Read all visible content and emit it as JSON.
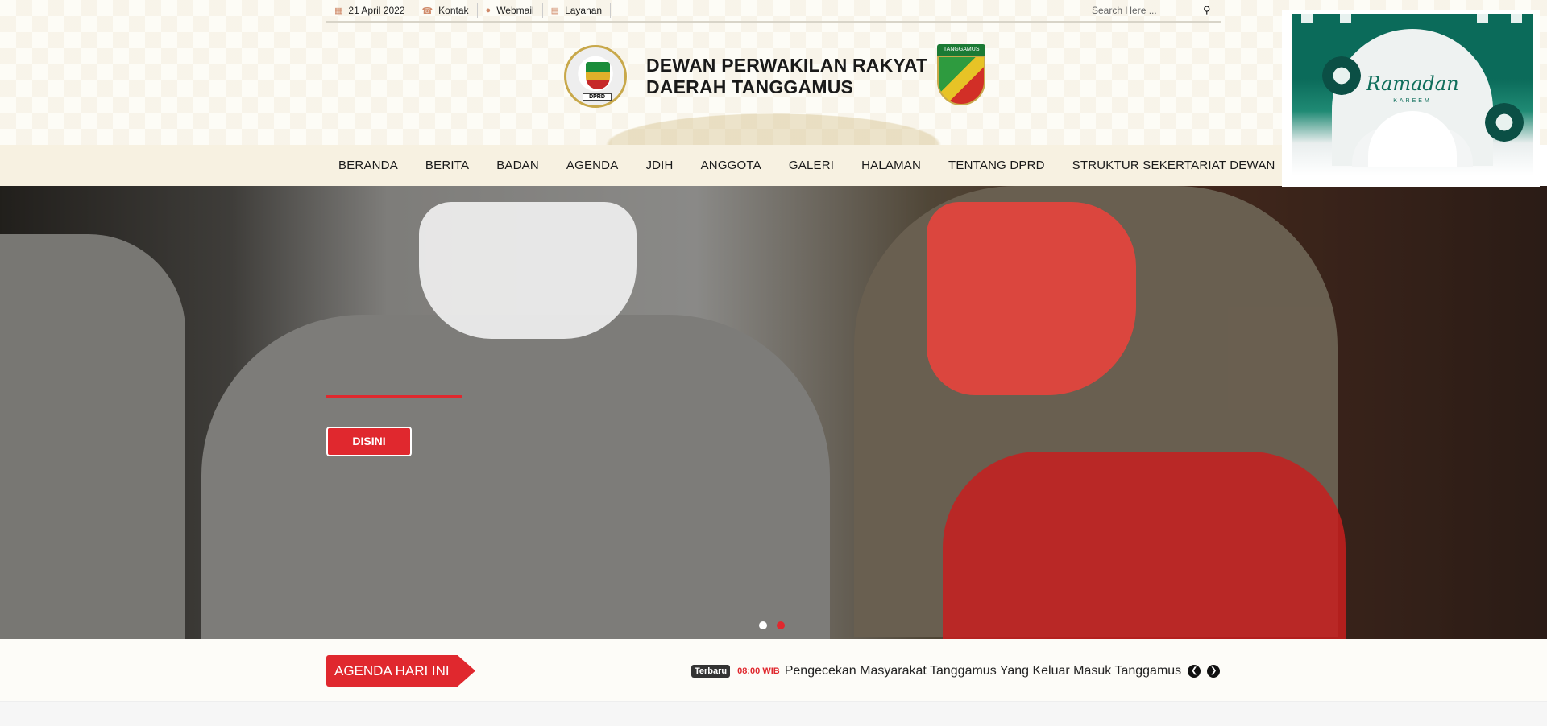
{
  "topbar": {
    "date": "21 April 2022",
    "links": [
      {
        "label": "Kontak",
        "icon": "phone-icon"
      },
      {
        "label": "Webmail",
        "icon": "user-icon"
      },
      {
        "label": "Layanan",
        "icon": "document-icon"
      }
    ],
    "search_placeholder": "Search Here ..."
  },
  "brand": {
    "line1": "DEWAN PERWAKILAN RAKYAT",
    "line2": "DAERAH TANGGAMUS",
    "logo_left_label": "DPRD",
    "logo_right_label": "TANGGAMUS"
  },
  "nav": {
    "items": [
      "BERANDA",
      "BERITA",
      "BADAN",
      "AGENDA",
      "JDIH",
      "ANGGOTA",
      "GALERI",
      "HALAMAN",
      "TENTANG DPRD",
      "STRUKTUR SEKERTARIAT DEWAN"
    ]
  },
  "hero": {
    "button_label": "DISINI",
    "slides": 2,
    "active_slide": 2
  },
  "agenda": {
    "label": "AGENDA HARI INI",
    "badge": "Terbaru",
    "time": "08:00 WIB",
    "headline": "Pengecekan Masyarakat Tanggamus Yang Keluar Masuk Tanggamus"
  },
  "popup": {
    "title": "Ramadan",
    "subtitle": "KAREEM",
    "close_label": "×"
  },
  "colors": {
    "accent": "#e0282e",
    "nav_bg": "#f7f1e1",
    "header_bg": "#fdfcf6",
    "popup_green": "#0e6e5b"
  }
}
